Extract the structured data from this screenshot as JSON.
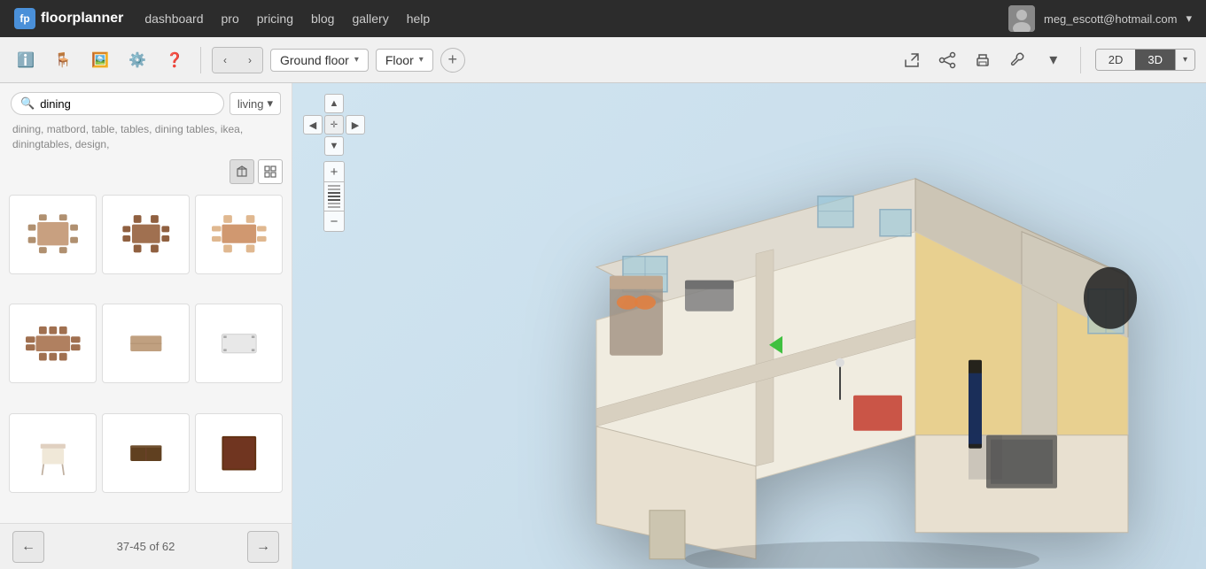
{
  "topnav": {
    "logo_text": "floorplanner",
    "logo_icon": "fp",
    "nav_items": [
      {
        "label": "dashboard",
        "id": "nav-dashboard"
      },
      {
        "label": "pro",
        "id": "nav-pro"
      },
      {
        "label": "pricing",
        "id": "nav-pricing"
      },
      {
        "label": "blog",
        "id": "nav-blog"
      },
      {
        "label": "gallery",
        "id": "nav-gallery"
      },
      {
        "label": "help",
        "id": "nav-help"
      }
    ],
    "user_email": "meg_escott@hotmail.com",
    "user_dropdown_arrow": "▾"
  },
  "toolbar": {
    "info_icon": "ℹ",
    "furniture_icon": "🪑",
    "photo_icon": "🖼",
    "settings_icon": "⚙",
    "help_icon": "?",
    "nav_prev": "‹",
    "nav_next": "›",
    "floor_label": "Ground floor",
    "floor_dropdown": "▾",
    "view_label": "Floor",
    "view_dropdown": "▾",
    "add_floor": "+",
    "export_icon": "↗",
    "share_icon": "≪",
    "print_icon": "🖨",
    "wrench_icon": "🔧",
    "more_icon": "▾",
    "view_2d": "2D",
    "view_3d": "3D",
    "view_3d_dropdown": "▾"
  },
  "sidebar": {
    "search_placeholder": "dining",
    "search_icon": "🔍",
    "category_label": "living",
    "category_arrow": "▾",
    "suggestions": "dining, matbord, table, tables, dining tables, ikea, diningtables, design,",
    "view_3d_icon": "cube",
    "view_2d_icon": "grid",
    "furniture_items": [
      {
        "id": 1,
        "name": "dining table with chairs 1",
        "color": "#c8a080"
      },
      {
        "id": 2,
        "name": "dining table with chairs 2",
        "color": "#a07050"
      },
      {
        "id": 3,
        "name": "dining table with chairs 3",
        "color": "#d09870"
      },
      {
        "id": 4,
        "name": "dining table 4",
        "color": "#b08060"
      },
      {
        "id": 5,
        "name": "dining table plain",
        "color": "#c0a080"
      },
      {
        "id": 6,
        "name": "dining table white leg",
        "color": "#d0d0d0"
      },
      {
        "id": 7,
        "name": "dining chair",
        "color": "#e0d0c0"
      },
      {
        "id": 8,
        "name": "dining table dark",
        "color": "#906040"
      },
      {
        "id": 9,
        "name": "dining table brown",
        "color": "#603010"
      }
    ],
    "pagination": {
      "prev_icon": "←",
      "next_icon": "→",
      "current": "37-45",
      "total": "62",
      "label": "37-45 of 62"
    }
  },
  "canvas": {
    "nav_up": "▲",
    "nav_down": "▼",
    "nav_left": "◀",
    "nav_right": "▶",
    "nav_center": "✛",
    "zoom_plus": "+",
    "zoom_minus": "−"
  }
}
